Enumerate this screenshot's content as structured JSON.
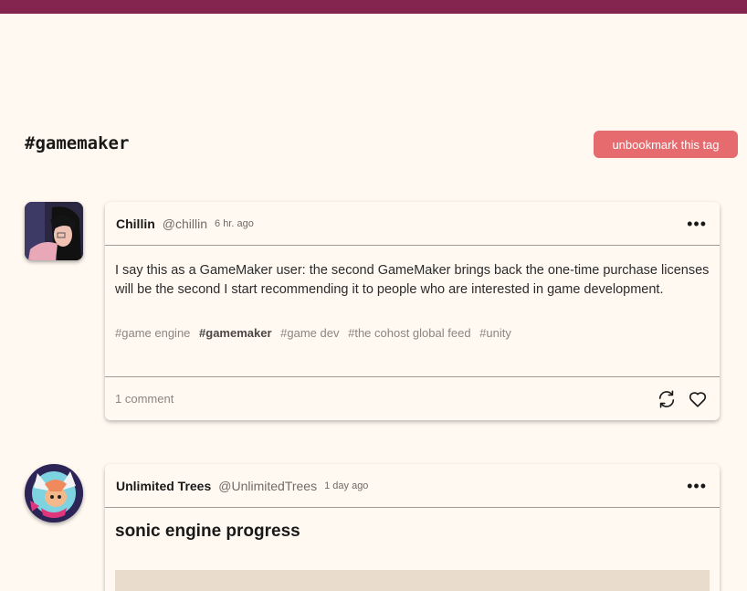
{
  "header": {
    "tag": "#gamemaker",
    "unbookmark_label": "unbookmark this tag"
  },
  "posts": [
    {
      "display_name": "Chillin",
      "handle": "@chillin",
      "time": "6 hr. ago",
      "body": "I say this as a GameMaker user: the second GameMaker brings back the one-time purchase licenses will be the second I start recommending it to people who are interested in game development.",
      "tags": [
        "#game engine",
        "#gamemaker",
        "#game dev",
        "#the cohost global feed",
        "#unity"
      ],
      "active_tag_index": 1,
      "comments": "1 comment"
    },
    {
      "display_name": "Unlimited Trees",
      "handle": "@UnlimitedTrees",
      "time": "1 day ago",
      "title": "sonic engine progress"
    }
  ],
  "icons": {
    "more": "more-horizontal-icon",
    "share": "repost-icon",
    "like": "heart-icon"
  },
  "colors": {
    "topbar": "#83254f",
    "background": "#fff9f2",
    "button": "#e56b6f"
  }
}
